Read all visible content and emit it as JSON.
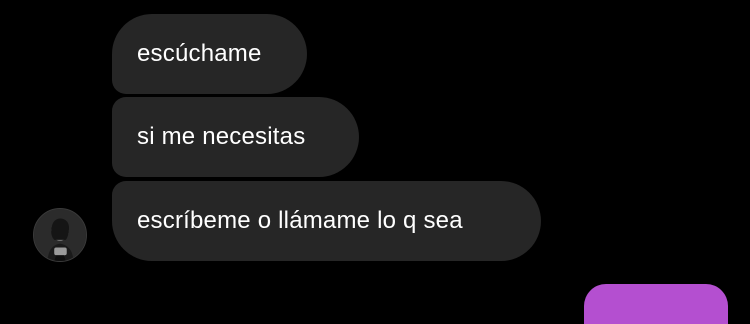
{
  "thread": {
    "messages": [
      {
        "text": "escúchame",
        "sender": "other"
      },
      {
        "text": "si me necesitas",
        "sender": "other"
      },
      {
        "text": "escríbeme o llámame lo q sea",
        "sender": "other"
      }
    ]
  },
  "colors": {
    "background": "#000000",
    "received_bubble": "#262626",
    "received_text": "#ffffff",
    "sent_bubble": "#b44fd0"
  },
  "icons": {
    "avatar": "profile-photo-avatar"
  }
}
